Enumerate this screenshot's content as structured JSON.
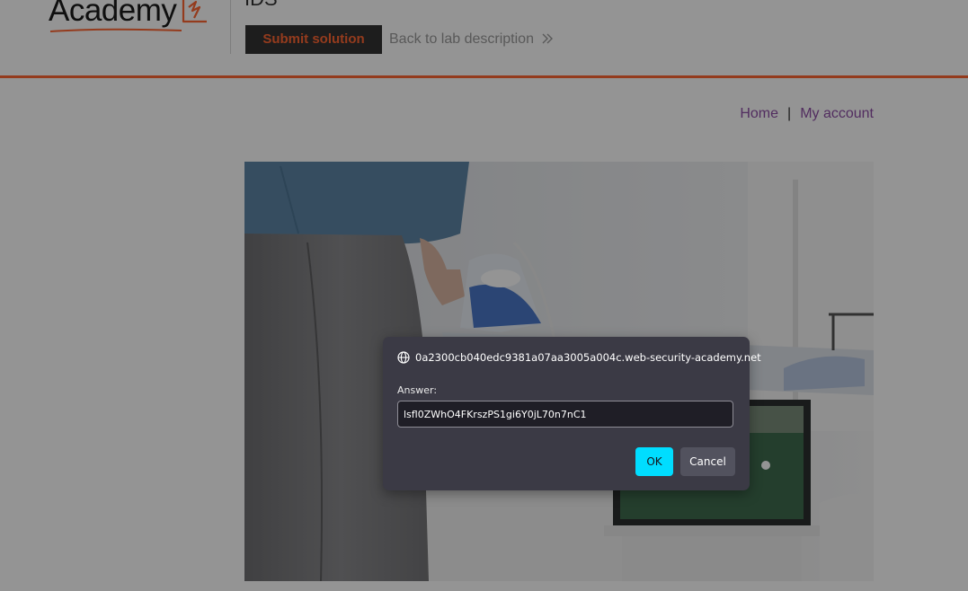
{
  "header": {
    "logo_text": "Academy",
    "lab_title": "IDS",
    "submit_label": "Submit solution",
    "back_label": "Back to lab description",
    "accent_color": "#ff6633"
  },
  "nav": {
    "home_label": "Home",
    "separator": "|",
    "account_label": "My account",
    "link_color": "#8d4ea5"
  },
  "product": {
    "image_icon": "product-photo-ironing"
  },
  "dialog": {
    "origin": "0a2300cb040edc9381a07aa3005a004c.web-security-academy.net",
    "origin_icon": "globe-icon",
    "label": "Answer:",
    "input_value": "lsfl0ZWhO4FKrszPS1gi6Y0jL70n7nC1",
    "ok_label": "OK",
    "cancel_label": "Cancel",
    "ok_color": "#00ddff"
  }
}
